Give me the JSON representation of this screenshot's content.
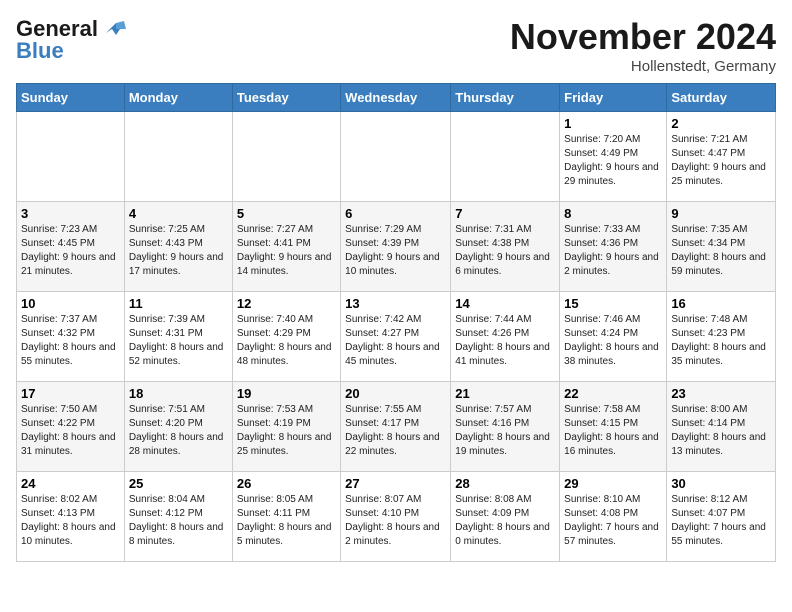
{
  "logo": {
    "line1": "General",
    "line2": "Blue"
  },
  "title": "November 2024",
  "location": "Hollenstedt, Germany",
  "days_header": [
    "Sunday",
    "Monday",
    "Tuesday",
    "Wednesday",
    "Thursday",
    "Friday",
    "Saturday"
  ],
  "weeks": [
    [
      {
        "day": "",
        "info": ""
      },
      {
        "day": "",
        "info": ""
      },
      {
        "day": "",
        "info": ""
      },
      {
        "day": "",
        "info": ""
      },
      {
        "day": "",
        "info": ""
      },
      {
        "day": "1",
        "info": "Sunrise: 7:20 AM\nSunset: 4:49 PM\nDaylight: 9 hours\nand 29 minutes."
      },
      {
        "day": "2",
        "info": "Sunrise: 7:21 AM\nSunset: 4:47 PM\nDaylight: 9 hours\nand 25 minutes."
      }
    ],
    [
      {
        "day": "3",
        "info": "Sunrise: 7:23 AM\nSunset: 4:45 PM\nDaylight: 9 hours\nand 21 minutes."
      },
      {
        "day": "4",
        "info": "Sunrise: 7:25 AM\nSunset: 4:43 PM\nDaylight: 9 hours\nand 17 minutes."
      },
      {
        "day": "5",
        "info": "Sunrise: 7:27 AM\nSunset: 4:41 PM\nDaylight: 9 hours\nand 14 minutes."
      },
      {
        "day": "6",
        "info": "Sunrise: 7:29 AM\nSunset: 4:39 PM\nDaylight: 9 hours\nand 10 minutes."
      },
      {
        "day": "7",
        "info": "Sunrise: 7:31 AM\nSunset: 4:38 PM\nDaylight: 9 hours\nand 6 minutes."
      },
      {
        "day": "8",
        "info": "Sunrise: 7:33 AM\nSunset: 4:36 PM\nDaylight: 9 hours\nand 2 minutes."
      },
      {
        "day": "9",
        "info": "Sunrise: 7:35 AM\nSunset: 4:34 PM\nDaylight: 8 hours\nand 59 minutes."
      }
    ],
    [
      {
        "day": "10",
        "info": "Sunrise: 7:37 AM\nSunset: 4:32 PM\nDaylight: 8 hours\nand 55 minutes."
      },
      {
        "day": "11",
        "info": "Sunrise: 7:39 AM\nSunset: 4:31 PM\nDaylight: 8 hours\nand 52 minutes."
      },
      {
        "day": "12",
        "info": "Sunrise: 7:40 AM\nSunset: 4:29 PM\nDaylight: 8 hours\nand 48 minutes."
      },
      {
        "day": "13",
        "info": "Sunrise: 7:42 AM\nSunset: 4:27 PM\nDaylight: 8 hours\nand 45 minutes."
      },
      {
        "day": "14",
        "info": "Sunrise: 7:44 AM\nSunset: 4:26 PM\nDaylight: 8 hours\nand 41 minutes."
      },
      {
        "day": "15",
        "info": "Sunrise: 7:46 AM\nSunset: 4:24 PM\nDaylight: 8 hours\nand 38 minutes."
      },
      {
        "day": "16",
        "info": "Sunrise: 7:48 AM\nSunset: 4:23 PM\nDaylight: 8 hours\nand 35 minutes."
      }
    ],
    [
      {
        "day": "17",
        "info": "Sunrise: 7:50 AM\nSunset: 4:22 PM\nDaylight: 8 hours\nand 31 minutes."
      },
      {
        "day": "18",
        "info": "Sunrise: 7:51 AM\nSunset: 4:20 PM\nDaylight: 8 hours\nand 28 minutes."
      },
      {
        "day": "19",
        "info": "Sunrise: 7:53 AM\nSunset: 4:19 PM\nDaylight: 8 hours\nand 25 minutes."
      },
      {
        "day": "20",
        "info": "Sunrise: 7:55 AM\nSunset: 4:17 PM\nDaylight: 8 hours\nand 22 minutes."
      },
      {
        "day": "21",
        "info": "Sunrise: 7:57 AM\nSunset: 4:16 PM\nDaylight: 8 hours\nand 19 minutes."
      },
      {
        "day": "22",
        "info": "Sunrise: 7:58 AM\nSunset: 4:15 PM\nDaylight: 8 hours\nand 16 minutes."
      },
      {
        "day": "23",
        "info": "Sunrise: 8:00 AM\nSunset: 4:14 PM\nDaylight: 8 hours\nand 13 minutes."
      }
    ],
    [
      {
        "day": "24",
        "info": "Sunrise: 8:02 AM\nSunset: 4:13 PM\nDaylight: 8 hours\nand 10 minutes."
      },
      {
        "day": "25",
        "info": "Sunrise: 8:04 AM\nSunset: 4:12 PM\nDaylight: 8 hours\nand 8 minutes."
      },
      {
        "day": "26",
        "info": "Sunrise: 8:05 AM\nSunset: 4:11 PM\nDaylight: 8 hours\nand 5 minutes."
      },
      {
        "day": "27",
        "info": "Sunrise: 8:07 AM\nSunset: 4:10 PM\nDaylight: 8 hours\nand 2 minutes."
      },
      {
        "day": "28",
        "info": "Sunrise: 8:08 AM\nSunset: 4:09 PM\nDaylight: 8 hours\nand 0 minutes."
      },
      {
        "day": "29",
        "info": "Sunrise: 8:10 AM\nSunset: 4:08 PM\nDaylight: 7 hours\nand 57 minutes."
      },
      {
        "day": "30",
        "info": "Sunrise: 8:12 AM\nSunset: 4:07 PM\nDaylight: 7 hours\nand 55 minutes."
      }
    ]
  ]
}
